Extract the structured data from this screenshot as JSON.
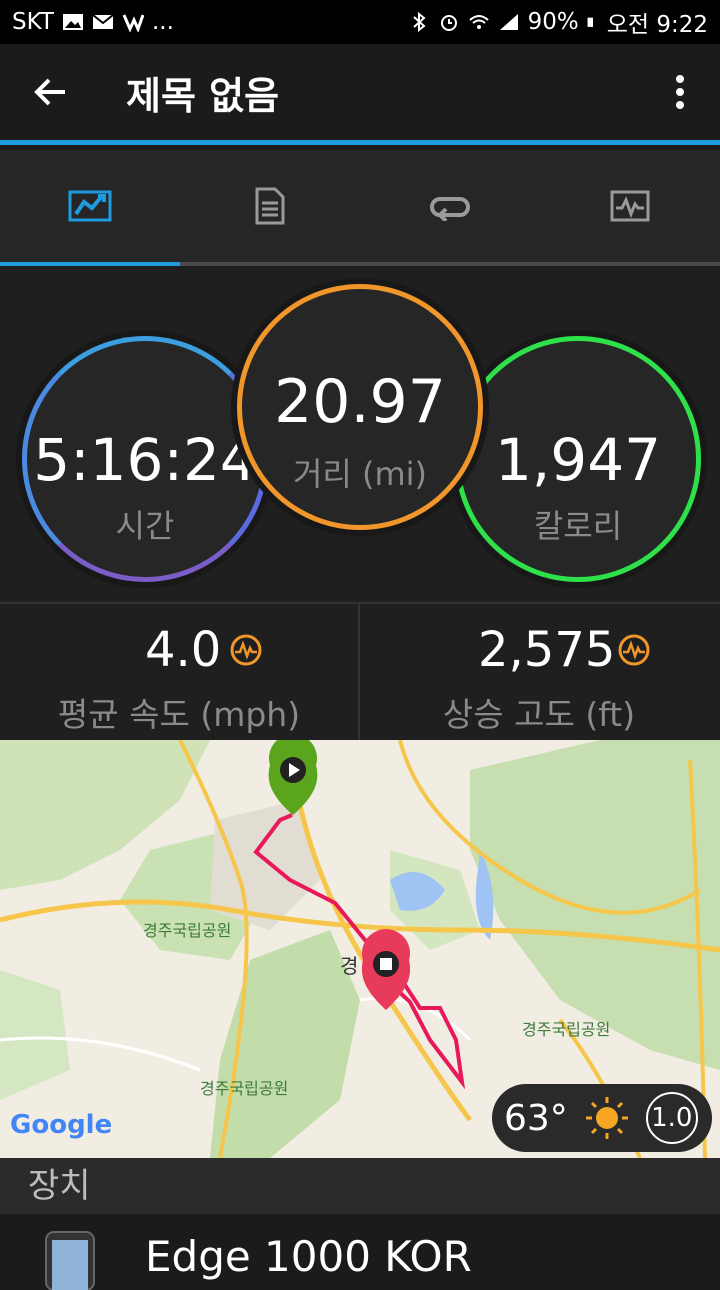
{
  "status": {
    "carrier": "SKT",
    "ellipsis": "...",
    "battery": "90%",
    "time": "오전 9:22"
  },
  "header": {
    "title": "제목 없음"
  },
  "tabs": [
    {
      "icon": "activity-icon",
      "selected": true
    },
    {
      "icon": "details-icon",
      "selected": false
    },
    {
      "icon": "laps-icon",
      "selected": false
    },
    {
      "icon": "chart-icon",
      "selected": false
    }
  ],
  "stats": {
    "time": {
      "value": "5:16:24",
      "label": "시간"
    },
    "distance": {
      "value": "20.97",
      "label": "거리 (mi)"
    },
    "calories": {
      "value": "1,947",
      "label": "칼로리"
    }
  },
  "metrics": {
    "avg_speed": {
      "value": "4.0",
      "label": "평균 속도 (mph)"
    },
    "elev_gain": {
      "value": "2,575",
      "label": "상승 고도 (ft)"
    }
  },
  "map": {
    "labels": [
      "경주국립공원",
      "경주국립공원",
      "경주국립공원",
      "경"
    ],
    "google": "Google",
    "weather_temp": "63°",
    "wind": "1.0"
  },
  "section": {
    "devices_title": "장치"
  },
  "device": {
    "name": "Edge 1000 KOR"
  },
  "colors": {
    "accent": "#1f9be0",
    "distance": "#f0962a",
    "calories": "#2ee04a",
    "route": "#e8185a",
    "start_pin": "#5aa51c",
    "end_pin": "#e83a5a"
  }
}
